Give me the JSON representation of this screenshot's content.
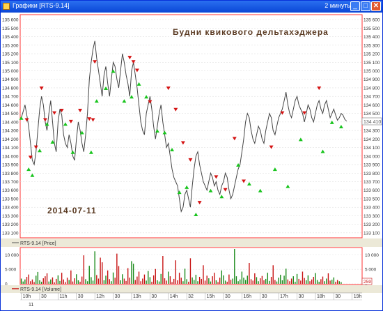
{
  "window": {
    "title": "Графики [RTS-9.14]",
    "timeframe": "2 минуты",
    "buttons": {
      "minimize": "_",
      "maximize": "□",
      "close": "✕"
    }
  },
  "annotations": {
    "heading": "Будни квикового дельтахэджера",
    "date": "2014-07-11"
  },
  "price_panel": {
    "legend": "RTS-9.14 [Price]",
    "y_labels": [
      "135 600",
      "135 500",
      "135 400",
      "135 300",
      "135 200",
      "135 100",
      "135 000",
      "134 900",
      "134 800",
      "134 700",
      "134 600",
      "134 500",
      "134 400",
      "134 300",
      "134 200",
      "134 100",
      "134 000",
      "133 900",
      "133 800",
      "133 700",
      "133 600",
      "133 500",
      "133 400",
      "133 300",
      "133 200",
      "133 100"
    ],
    "current_price": "134 410",
    "y_range": [
      133050,
      135650
    ]
  },
  "volume_panel": {
    "legend": "RTS-9.14 [Volume]",
    "y_labels": [
      "10 000",
      "5 000",
      "0"
    ],
    "current_volume": "259",
    "y_range": [
      0,
      12000
    ]
  },
  "time_axis": {
    "labels": [
      "10h",
      "30",
      "11h",
      "30",
      "12h",
      "30",
      "13h",
      "30",
      "14h",
      "32",
      "15h",
      "30",
      "16h",
      "30",
      "17h",
      "30",
      "18h",
      "30",
      "19h"
    ],
    "date_label": "11"
  },
  "colors": {
    "price_line": "#444444",
    "sell_marker": "#d41414",
    "buy_marker": "#19c41e",
    "volume_up": "#1a8a1a",
    "volume_down": "#c81414",
    "heading": "#5a3a22",
    "frame": "#ff4040"
  },
  "chart_data": {
    "type": "line",
    "series": [
      {
        "name": "RTS-9.14",
        "x_hours": [
          10.0,
          10.05,
          10.1,
          10.15,
          10.2,
          10.25,
          10.3,
          10.35,
          10.4,
          10.45,
          10.5,
          10.55,
          10.6,
          10.65,
          10.7,
          10.75,
          10.8,
          10.85,
          10.9,
          10.95,
          11.0,
          11.05,
          11.1,
          11.15,
          11.2,
          11.25,
          11.3,
          11.35,
          11.4,
          11.45,
          11.5,
          11.55,
          11.6,
          11.65,
          11.7,
          11.75,
          11.8,
          11.85,
          11.9,
          11.95,
          12.0,
          12.05,
          12.1,
          12.15,
          12.2,
          12.25,
          12.3,
          12.35,
          12.4,
          12.45,
          12.5,
          12.55,
          12.6,
          12.65,
          12.7,
          12.75,
          12.8,
          12.85,
          12.9,
          12.95,
          13.0,
          13.05,
          13.1,
          13.15,
          13.2,
          13.25,
          13.3,
          13.35,
          13.4,
          13.45,
          13.5,
          13.55,
          13.6,
          13.65,
          13.7,
          13.75,
          13.8,
          13.85,
          13.9,
          13.95,
          14.0,
          14.05,
          14.1,
          14.15,
          14.2,
          14.25,
          14.3,
          14.35,
          14.4,
          14.45,
          14.5,
          14.55,
          14.6,
          14.65,
          14.7,
          14.75,
          14.8,
          14.85,
          14.9,
          14.95,
          15.0,
          15.05,
          15.1,
          15.15,
          15.2,
          15.25,
          15.3,
          15.35,
          15.4,
          15.45,
          15.5,
          15.55,
          15.6,
          15.65,
          15.7,
          15.75,
          15.8,
          15.85,
          15.9,
          15.95,
          16.0,
          16.05,
          16.1,
          16.15,
          16.2,
          16.25,
          16.3,
          16.35,
          16.4,
          16.45,
          16.5,
          16.55,
          16.6,
          16.65,
          16.7,
          16.75,
          16.8,
          16.85,
          16.9,
          16.95,
          17.0,
          17.05,
          17.1,
          17.15,
          17.2,
          17.25,
          17.3,
          17.35,
          17.4,
          17.45,
          17.5,
          17.55,
          17.6,
          17.65,
          17.7,
          17.75,
          17.8,
          17.85,
          17.9,
          17.95,
          18.0,
          18.05,
          18.1,
          18.15,
          18.2,
          18.25,
          18.3,
          18.35,
          18.4,
          18.45,
          18.5,
          18.55,
          18.6,
          18.65,
          18.7,
          18.75,
          18.8,
          18.85,
          18.9,
          18.95,
          19.0,
          19.05,
          19.1,
          19.15,
          19.2
        ],
        "price": [
          134450,
          134520,
          134600,
          134480,
          134350,
          134150,
          133950,
          133900,
          134050,
          134300,
          134550,
          134700,
          134600,
          134400,
          134300,
          134500,
          134650,
          134400,
          134150,
          134050,
          134400,
          134550,
          134480,
          134250,
          134150,
          134100,
          134250,
          134150,
          134000,
          133950,
          134200,
          134400,
          134300,
          134150,
          134050,
          134250,
          134500,
          134900,
          135100,
          135250,
          135350,
          135150,
          135000,
          134850,
          134700,
          134950,
          135050,
          134850,
          134700,
          134900,
          135100,
          135050,
          134900,
          134800,
          135000,
          135200,
          135100,
          134950,
          134850,
          134700,
          135000,
          135100,
          134950,
          134800,
          134600,
          134400,
          134300,
          134250,
          134500,
          134600,
          134700,
          134550,
          134350,
          134200,
          134350,
          134500,
          134600,
          134400,
          134250,
          134100,
          134150,
          134000,
          133850,
          133750,
          133700,
          133650,
          133500,
          133350,
          133400,
          133550,
          133600,
          133500,
          133400,
          133650,
          133850,
          134000,
          134050,
          133900,
          133800,
          133700,
          133650,
          133600,
          133700,
          133800,
          133750,
          133650,
          133700,
          133600,
          133550,
          133650,
          133700,
          133800,
          133750,
          133600,
          133500,
          133550,
          133650,
          133750,
          133850,
          133900,
          134050,
          134200,
          134400,
          134500,
          134450,
          134300,
          134200,
          134150,
          134250,
          134350,
          134300,
          134200,
          134150,
          134300,
          134400,
          134500,
          134450,
          134300,
          134250,
          134350,
          134450,
          134500,
          134550,
          134650,
          134750,
          134600,
          134500,
          134450,
          134550,
          134650,
          134700,
          134600,
          134550,
          134500,
          134400,
          134500,
          134600,
          134550,
          134450,
          134400,
          134500,
          134600,
          134650,
          134550,
          134500,
          134600,
          134650,
          134550,
          134450,
          134500,
          134550,
          134480,
          134420,
          134450,
          134500,
          134480,
          134430,
          134410
        ]
      }
    ],
    "signals": {
      "sell": [
        [
          10.15,
          134420
        ],
        [
          10.25,
          133980
        ],
        [
          10.4,
          134100
        ],
        [
          10.55,
          134790
        ],
        [
          10.65,
          134420
        ],
        [
          10.9,
          134500
        ],
        [
          11.1,
          134530
        ],
        [
          11.35,
          134400
        ],
        [
          11.6,
          134530
        ],
        [
          11.85,
          134430
        ],
        [
          11.95,
          134420
        ],
        [
          12.0,
          135100
        ],
        [
          12.95,
          135150
        ],
        [
          13.05,
          135100
        ],
        [
          13.15,
          135000
        ],
        [
          13.5,
          134630
        ],
        [
          14.0,
          134790
        ],
        [
          14.2,
          134540
        ],
        [
          14.4,
          134150
        ],
        [
          14.6,
          133950
        ],
        [
          14.85,
          133450
        ],
        [
          15.3,
          133750
        ],
        [
          15.55,
          133600
        ],
        [
          15.8,
          134200
        ],
        [
          16.05,
          133700
        ],
        [
          16.8,
          134100
        ],
        [
          17.1,
          134500
        ],
        [
          17.7,
          134500
        ],
        [
          18.1,
          134790
        ]
      ],
      "buy": [
        [
          10.0,
          134450
        ],
        [
          10.2,
          133850
        ],
        [
          10.3,
          133780
        ],
        [
          10.5,
          134070
        ],
        [
          10.7,
          134380
        ],
        [
          10.85,
          134170
        ],
        [
          11.2,
          134380
        ],
        [
          11.4,
          134050
        ],
        [
          11.65,
          134280
        ],
        [
          11.9,
          134050
        ],
        [
          12.05,
          134650
        ],
        [
          12.3,
          134800
        ],
        [
          12.5,
          135000
        ],
        [
          12.8,
          134650
        ],
        [
          13.0,
          134700
        ],
        [
          13.2,
          134850
        ],
        [
          13.4,
          134700
        ],
        [
          13.7,
          134300
        ],
        [
          13.9,
          134280
        ],
        [
          14.1,
          134080
        ],
        [
          14.3,
          133580
        ],
        [
          14.5,
          133640
        ],
        [
          14.75,
          133320
        ],
        [
          15.15,
          133600
        ],
        [
          15.45,
          133530
        ],
        [
          15.9,
          133900
        ],
        [
          16.2,
          133680
        ],
        [
          16.5,
          133600
        ],
        [
          16.9,
          133850
        ],
        [
          17.25,
          133650
        ],
        [
          17.6,
          134200
        ],
        [
          18.2,
          134060
        ],
        [
          18.45,
          134400
        ],
        [
          18.7,
          134350
        ]
      ]
    },
    "volume": [
      1800,
      800,
      1500,
      2400,
      3200,
      900,
      1500,
      600,
      2800,
      4100,
      1200,
      700,
      1900,
      2600,
      3600,
      800,
      1500,
      2200,
      500,
      1700,
      2900,
      1000,
      3800,
      1500,
      600,
      2100,
      1300,
      4600,
      800,
      1900,
      3300,
      1200,
      700,
      2500,
      9800,
      1600,
      900,
      6200,
      2300,
      1100,
      11200,
      3000,
      1800,
      9000,
      7400,
      1200,
      2800,
      4600,
      1600,
      900,
      3900,
      2100,
      10400,
      6100,
      1200,
      3300,
      1800,
      1000,
      5400,
      2100,
      7800,
      6900,
      1300,
      2500,
      4200,
      900,
      1800,
      3200,
      1100,
      4400,
      2300,
      700,
      2900,
      5100,
      1200,
      800,
      3400,
      9600,
      1900,
      1100,
      4200,
      2600,
      600,
      1700,
      8100,
      1200,
      3800,
      2100,
      900,
      5200,
      1600,
      700,
      8800,
      2200,
      1300,
      3100,
      900,
      2400,
      1700,
      6400,
      1100,
      2800,
      1900,
      800,
      2600,
      3800,
      1200,
      600,
      2100,
      4600,
      2900,
      1100,
      700,
      3200,
      1400,
      1800,
      12000,
      2600,
      900,
      1500,
      4200,
      2100,
      1300,
      2800,
      7200,
      1600,
      1100,
      3600,
      2300,
      900,
      1900,
      2700,
      1200,
      1700,
      3800,
      1000,
      2400,
      6400,
      1300,
      800,
      2100,
      3100,
      1200,
      2800,
      5200,
      1500,
      900,
      1800,
      2600,
      700,
      3400,
      1700,
      1100,
      4200,
      2000,
      1200,
      2900,
      900,
      1500,
      2400,
      3700,
      1300,
      700,
      1600,
      2500,
      900,
      1800,
      3600,
      1100,
      1400,
      2200,
      700,
      1300,
      900,
      600
    ]
  }
}
